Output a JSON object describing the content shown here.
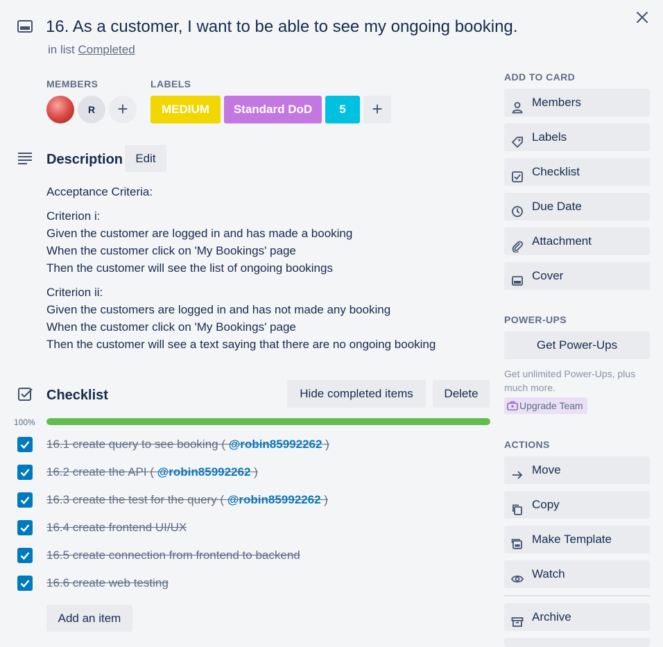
{
  "card": {
    "title": "16. As a customer, I want to be able to see my ongoing booking.",
    "in_list_prefix": "in list",
    "list_name": "Completed"
  },
  "members": {
    "heading": "MEMBERS",
    "initial": "R",
    "add": "+"
  },
  "labels": {
    "heading": "LABELS",
    "items": [
      {
        "text": "MEDIUM",
        "color": "#f2d600"
      },
      {
        "text": "Standard DoD",
        "color": "#c377e0"
      },
      {
        "text": "5",
        "color": "#00c2e0"
      }
    ],
    "add": "+"
  },
  "description": {
    "heading": "Description",
    "edit_label": "Edit",
    "lines": [
      "Acceptance Criteria:",
      "Criterion i:",
      "Given the customer are logged in and has made a booking",
      "When the customer click on 'My Bookings' page",
      "Then the customer will see the list of ongoing bookings",
      "Criterion ii:",
      "Given the customers are logged in and has not made any booking",
      "When the customer click on 'My Bookings' page",
      "Then the customer will see a text saying that there are no ongoing booking"
    ]
  },
  "checklist": {
    "heading": "Checklist",
    "hide_label": "Hide completed items",
    "delete_label": "Delete",
    "progress_text": "100%",
    "progress": 1.0,
    "items": [
      {
        "text": "16.1 create query to see booking ( ",
        "mention": "@robin85992262",
        "suffix": " )"
      },
      {
        "text": "16.2 create the API ( ",
        "mention": "@robin85992262",
        "suffix": " )"
      },
      {
        "text": "16.3 create the test for the query ( ",
        "mention": "@robin85992262",
        "suffix": " )"
      },
      {
        "text": "16.4 create frontend UI/UX",
        "mention": "",
        "suffix": ""
      },
      {
        "text": "16.5 create connection from frontend to backend",
        "mention": "",
        "suffix": ""
      },
      {
        "text": "16.6 create web testing",
        "mention": "",
        "suffix": ""
      }
    ],
    "add_item_label": "Add an item"
  },
  "sidebar": {
    "add_to_card_heading": "ADD TO CARD",
    "add_to_card": [
      "Members",
      "Labels",
      "Checklist",
      "Due Date",
      "Attachment",
      "Cover"
    ],
    "powerups_heading": "POWER-UPS",
    "get_powerups": "Get Power-Ups",
    "powerups_note": "Get unlimited Power-Ups, plus much more.",
    "upgrade_label": "Upgrade Team",
    "actions_heading": "ACTIONS",
    "actions": [
      "Move",
      "Copy",
      "Make Template",
      "Watch"
    ],
    "archive_label": "Archive"
  },
  "colors": {
    "accent": "#0079bf",
    "progress_complete": "#61bd4f"
  },
  "icons": {
    "card": "card-icon",
    "close": "close-icon",
    "description": "description-icon",
    "checklist": "checklist-icon"
  }
}
